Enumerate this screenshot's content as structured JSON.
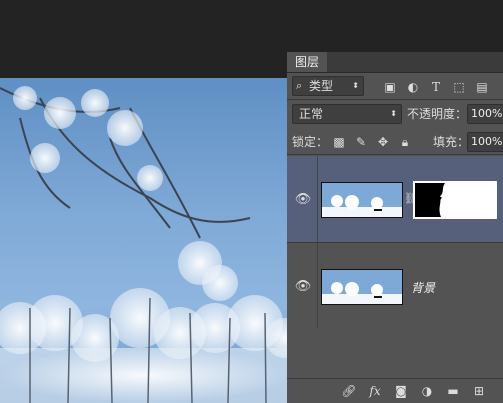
{
  "panel": {
    "tab_label": "图层",
    "filter": {
      "icon": "search-icon",
      "label": "类型"
    },
    "blend_mode": "正常",
    "opacity_label": "不透明度：",
    "opacity_value": "100%",
    "lock_label": "锁定：",
    "fill_label": "填充：",
    "fill_value": "100%",
    "layers": [
      {
        "name": "",
        "selected": true,
        "has_mask": true,
        "visible": true
      },
      {
        "name": "背景",
        "selected": false,
        "has_mask": false,
        "visible": true
      }
    ],
    "bottom_icons": [
      "link-icon",
      "fx-icon",
      "add-mask-icon",
      "adjustment-icon",
      "folder-icon",
      "new-layer-icon"
    ],
    "bottom_fx_label": "fx"
  },
  "colors": {
    "panel_bg": "#535353",
    "selected_layer": "#56607a",
    "canvas_sky": "#7ea8d6"
  }
}
